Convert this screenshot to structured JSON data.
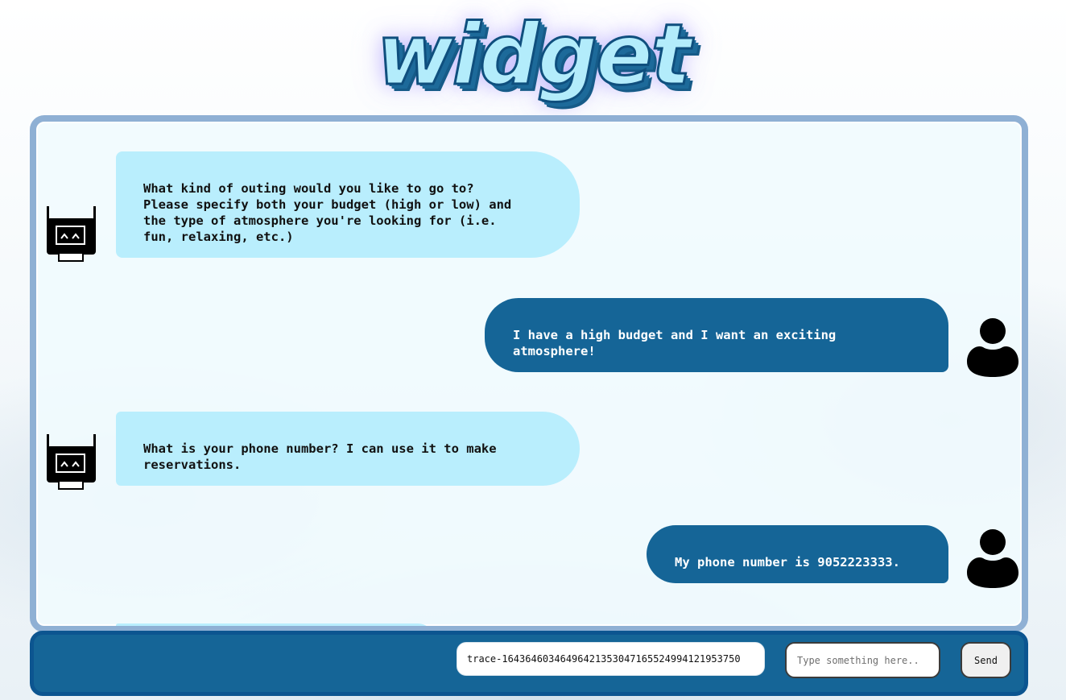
{
  "app": {
    "title": "widget"
  },
  "chat": {
    "messages": [
      {
        "sender": "bot",
        "avatar_icon": "robot-icon",
        "text": "What kind of outing would you like to go to?\nPlease specify both your budget (high or low) and\nthe type of atmosphere you're looking for (i.e.\nfun, relaxing, etc.)"
      },
      {
        "sender": "user",
        "avatar_icon": "user-icon",
        "text": "I have a high budget and I want an exciting\natmosphere!"
      },
      {
        "sender": "bot",
        "avatar_icon": "robot-icon",
        "text": "What is your phone number? I can use it to make\nreservations."
      },
      {
        "sender": "user",
        "avatar_icon": "user-icon",
        "text": "My phone number is 9052223333."
      }
    ]
  },
  "input_bar": {
    "trace_id": "trace-16436460346496421353047165524994121953750",
    "message_placeholder": "Type something here..",
    "message_value": "",
    "send_label": "Send"
  },
  "colors": {
    "bot_bubble": "#b9eefd",
    "user_bubble": "#156597",
    "frame_border": "#8fb0d4",
    "input_bar": "#156597"
  }
}
